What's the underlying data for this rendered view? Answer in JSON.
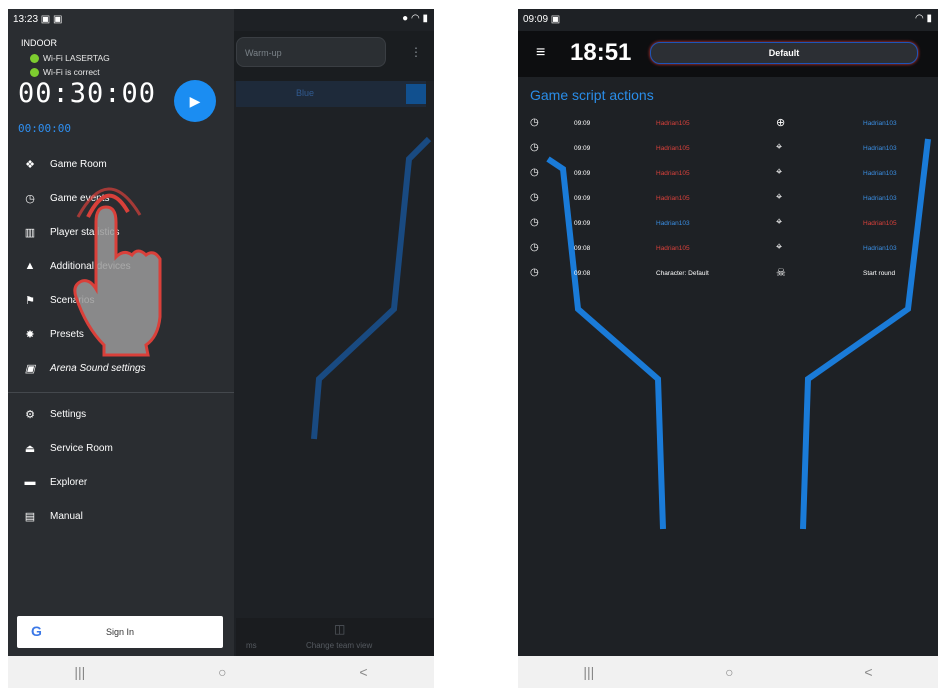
{
  "left": {
    "status_time": "13:23 ▣ ▣",
    "status_icons": "● ◠ ▮",
    "underlying": {
      "warmup": "Warm-up",
      "team_label": "Blue",
      "bottom_label1": "ms",
      "bottom_label2": "Change team view"
    },
    "drawer": {
      "arena": "INDOOR",
      "wifi1": "Wi-Fi LASERTAG",
      "wifi2": "Wi-Fi is correct",
      "timer": "00:30:00",
      "subtimer": "00:00:00",
      "play_icon": "▶",
      "menu_top": [
        {
          "label": "Game Room",
          "icon": "❖"
        },
        {
          "label": "Game events",
          "icon": "◷"
        },
        {
          "label": "Player statistics",
          "icon": "▥"
        },
        {
          "label": "Additional devices",
          "icon": "▲"
        },
        {
          "label": "Scenarios",
          "icon": "⚑"
        },
        {
          "label": "Presets",
          "icon": "✸"
        },
        {
          "label": "Arena Sound settings",
          "icon": "▣"
        }
      ],
      "menu_bottom": [
        {
          "label": "Settings",
          "icon": "⚙"
        },
        {
          "label": "Service Room",
          "icon": "⏏"
        },
        {
          "label": "Explorer",
          "icon": "▬"
        },
        {
          "label": "Manual",
          "icon": "▤"
        }
      ],
      "signin": "Sign In",
      "google_g": "G"
    },
    "nav": [
      "|||",
      "○",
      "<"
    ]
  },
  "right": {
    "status_time": "09:09 ▣",
    "status_icons": "◠ ▮",
    "menu_icon": "≡",
    "clock": "18:51",
    "profile": "Default",
    "heading": "Game script actions",
    "rows": [
      {
        "time": "09:09",
        "actor": "Hadrian105",
        "actor_color": "red",
        "icon": "⊕",
        "target": "Hadrian103",
        "target_color": "blue"
      },
      {
        "time": "09:09",
        "actor": "Hadrian105",
        "actor_color": "red",
        "icon": "⌖",
        "target": "Hadrian103",
        "target_color": "blue"
      },
      {
        "time": "09:09",
        "actor": "Hadrian105",
        "actor_color": "red",
        "icon": "⌖",
        "target": "Hadrian103",
        "target_color": "blue"
      },
      {
        "time": "09:09",
        "actor": "Hadrian105",
        "actor_color": "red",
        "icon": "⌖",
        "target": "Hadrian103",
        "target_color": "blue"
      },
      {
        "time": "09:09",
        "actor": "Hadrian103",
        "actor_color": "blue",
        "icon": "⌖",
        "target": "Hadrian105",
        "target_color": "red"
      },
      {
        "time": "09:08",
        "actor": "Hadrian105",
        "actor_color": "red",
        "icon": "⌖",
        "target": "Hadrian103",
        "target_color": "blue"
      },
      {
        "time": "09:08",
        "actor": "Character: Default",
        "actor_color": "white",
        "icon": "☠",
        "target": "Start round",
        "target_color": "white"
      }
    ],
    "nav": [
      "|||",
      "○",
      "<"
    ]
  }
}
